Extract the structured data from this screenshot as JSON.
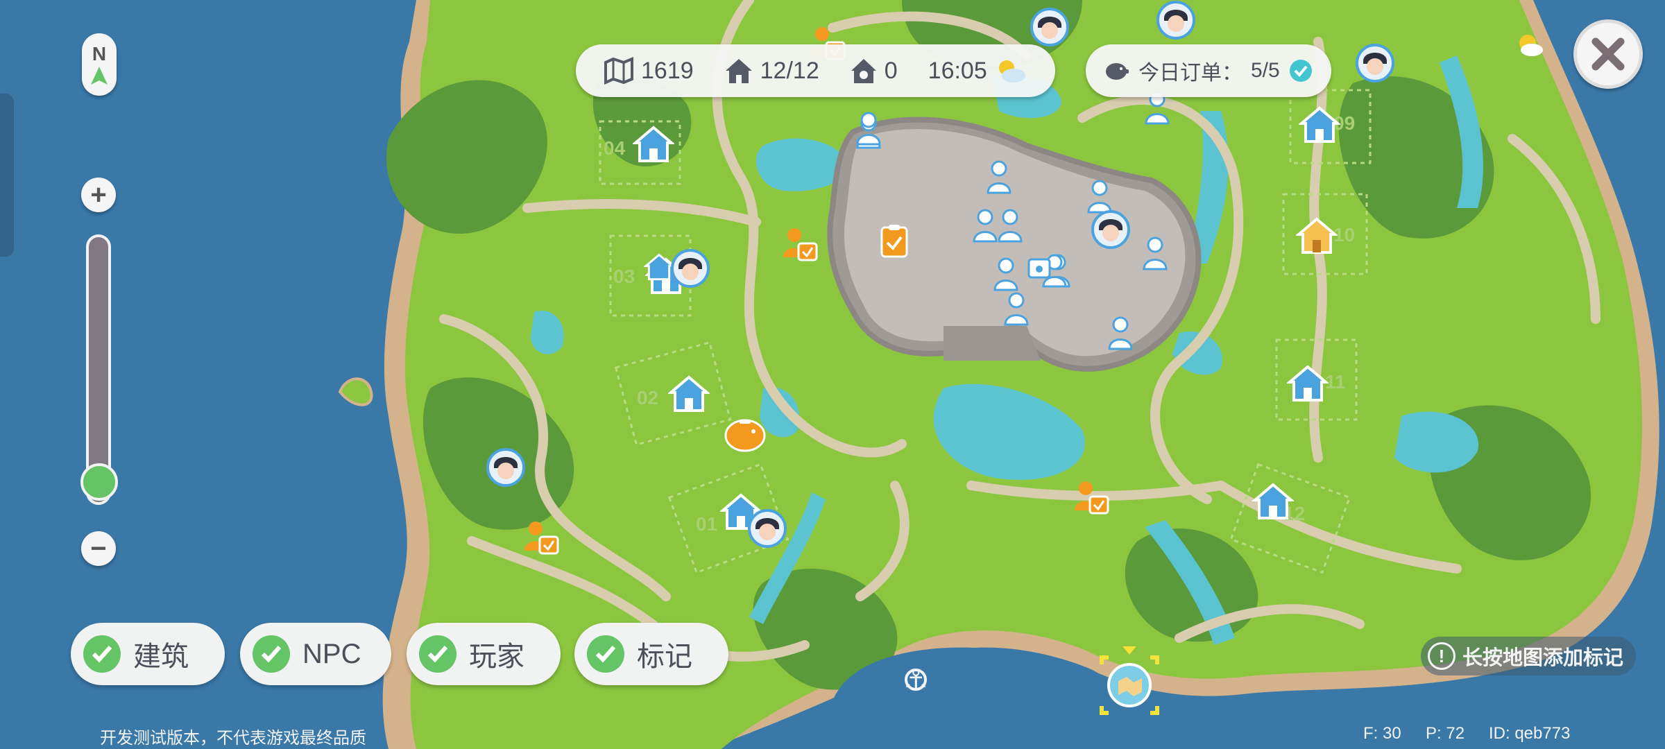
{
  "hud": {
    "map_count": "1619",
    "houses": "12/12",
    "pets": "0",
    "time": "16:05",
    "order_label": "今日订单：",
    "order_count": "5/5"
  },
  "compass": {
    "north": "N"
  },
  "zoom": {
    "plus": "+",
    "minus": "−",
    "level": 0.1
  },
  "filters": [
    {
      "label": "建筑",
      "checked": true
    },
    {
      "label": "NPC",
      "checked": true
    },
    {
      "label": "玩家",
      "checked": true
    },
    {
      "label": "标记",
      "checked": true
    }
  ],
  "tip": "长按地图添加标记",
  "footer": {
    "disclaimer": "开发测试版本，不代表游戏最终品质",
    "f": "F: 30",
    "p": "P: 72",
    "id": "ID: qeb773"
  },
  "lots": [
    "04",
    "03",
    "02",
    "01",
    "09",
    "10",
    "11",
    "12"
  ],
  "colors": {
    "sea": "#3a78a8",
    "grass": "#8cc63f",
    "forest": "#5b9a3a",
    "road": "#d9cdb0",
    "town": "#b3aeaa",
    "water": "#5bc3cf",
    "accent_orange": "#f39a1e",
    "house_blue": "#4aa3df",
    "check_green": "#65c466"
  }
}
